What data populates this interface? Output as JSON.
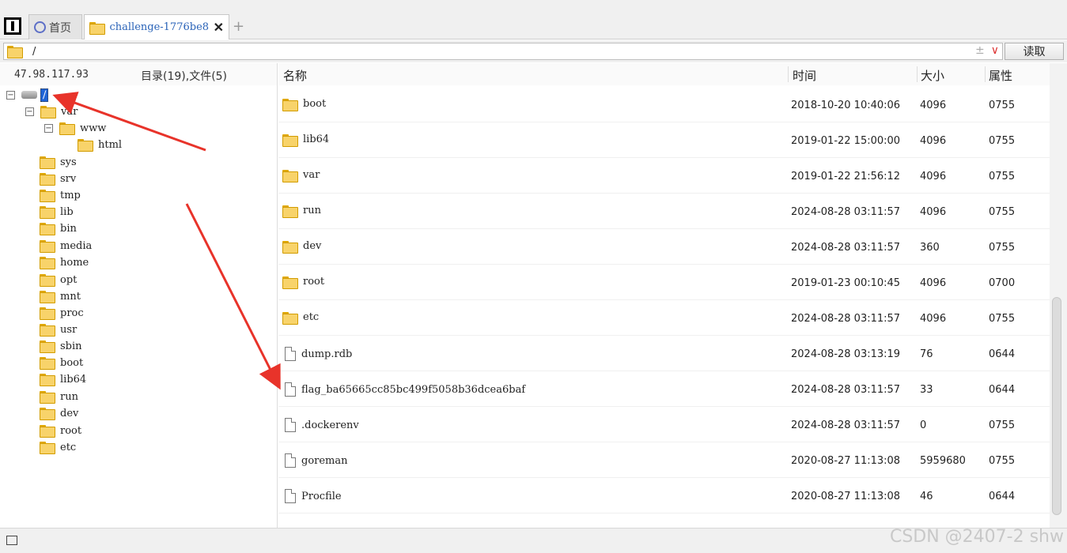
{
  "tabs": {
    "home_label": "首页",
    "active_label": "challenge-1776be8.",
    "add_symbol": "+",
    "close_symbol": "✕"
  },
  "address": {
    "path": "/",
    "extra_left": "±",
    "extra_down": "∨",
    "read_button": "读取"
  },
  "tree_panel": {
    "ip": "47.98.117.93",
    "counts": "目录(19),文件(5)",
    "root": "/",
    "items": [
      {
        "label": "var",
        "expander": "⊟"
      },
      {
        "label": "www",
        "expander": "⊟"
      },
      {
        "label": "html"
      },
      {
        "label": "sys"
      },
      {
        "label": "srv"
      },
      {
        "label": "tmp"
      },
      {
        "label": "lib"
      },
      {
        "label": "bin"
      },
      {
        "label": "media"
      },
      {
        "label": "home"
      },
      {
        "label": "opt"
      },
      {
        "label": "mnt"
      },
      {
        "label": "proc"
      },
      {
        "label": "usr"
      },
      {
        "label": "sbin"
      },
      {
        "label": "boot"
      },
      {
        "label": "lib64"
      },
      {
        "label": "run"
      },
      {
        "label": "dev"
      },
      {
        "label": "root"
      },
      {
        "label": "etc"
      }
    ]
  },
  "list": {
    "headers": {
      "name": "名称",
      "time": "时间",
      "size": "大小",
      "attr": "属性"
    },
    "rows": [
      {
        "name": "boot",
        "type": "folder",
        "time": "2018-10-20 10:40:06",
        "size": "4096",
        "attr": "0755"
      },
      {
        "name": "lib64",
        "type": "folder",
        "time": "2019-01-22 15:00:00",
        "size": "4096",
        "attr": "0755"
      },
      {
        "name": "var",
        "type": "folder",
        "time": "2019-01-22 21:56:12",
        "size": "4096",
        "attr": "0755"
      },
      {
        "name": "run",
        "type": "folder",
        "time": "2024-08-28 03:11:57",
        "size": "4096",
        "attr": "0755"
      },
      {
        "name": "dev",
        "type": "folder",
        "time": "2024-08-28 03:11:57",
        "size": "360",
        "attr": "0755"
      },
      {
        "name": "root",
        "type": "folder",
        "time": "2019-01-23 00:10:45",
        "size": "4096",
        "attr": "0700"
      },
      {
        "name": "etc",
        "type": "folder",
        "time": "2024-08-28 03:11:57",
        "size": "4096",
        "attr": "0755"
      },
      {
        "name": "dump.rdb",
        "type": "file",
        "time": "2024-08-28 03:13:19",
        "size": "76",
        "attr": "0644"
      },
      {
        "name": "flag_ba65665cc85bc499f5058b36dcea6baf",
        "type": "file",
        "time": "2024-08-28 03:11:57",
        "size": "33",
        "attr": "0644"
      },
      {
        "name": ".dockerenv",
        "type": "file",
        "time": "2024-08-28 03:11:57",
        "size": "0",
        "attr": "0755"
      },
      {
        "name": "goreman",
        "type": "file",
        "time": "2020-08-27 11:13:08",
        "size": "5959680",
        "attr": "0755"
      },
      {
        "name": "Procfile",
        "type": "file",
        "time": "2020-08-27 11:13:08",
        "size": "46",
        "attr": "0644"
      }
    ]
  },
  "watermark": "CSDN @2407-2 shw",
  "colors": {
    "arrow": "#e8332a",
    "selection": "#1f64d6",
    "folder": "#f8d36a"
  }
}
